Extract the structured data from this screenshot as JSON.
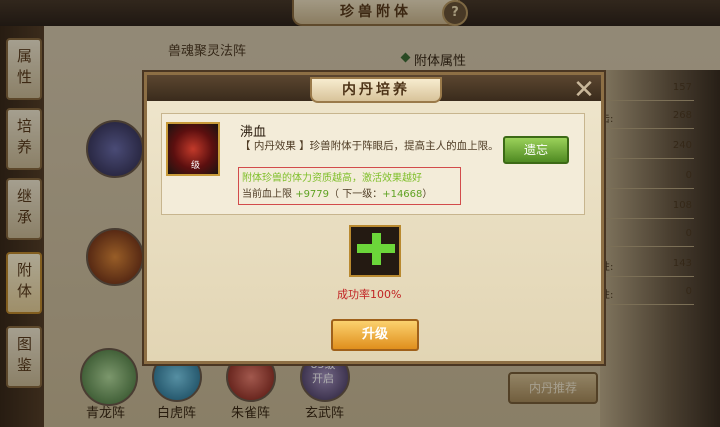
{
  "page_title": "珍兽附体",
  "side_tabs": [
    "属性",
    "培养",
    "继承",
    "附体",
    "图鉴"
  ],
  "formation": {
    "title": "兽魂聚灵法阵",
    "slots": [
      {
        "label": "青龙阵",
        "color": "#5f9a45"
      },
      {
        "label": "白虎阵",
        "color": "#3a8fb0"
      },
      {
        "label": "朱雀阵",
        "color": "#c0392b"
      },
      {
        "label": "玄武阵",
        "color": "#6b5a87",
        "lock_level": "85级",
        "lock_text": "开启"
      }
    ]
  },
  "attributes": {
    "title": "附体属性",
    "rows": [
      {
        "label": "",
        "value": "157"
      },
      {
        "label": "击:",
        "value": "268"
      },
      {
        "label": "",
        "value": "240"
      },
      {
        "label": "",
        "value": "0"
      },
      {
        "label": "",
        "value": "108"
      },
      {
        "label": "",
        "value": "0"
      },
      {
        "label": "性:",
        "value": "143"
      },
      {
        "label": "性:",
        "value": "0"
      }
    ],
    "recommend_button": "内丹推荐"
  },
  "modal": {
    "title": "内丹培养",
    "item_name": "沸血",
    "item_level": "级",
    "effect_text": "【 内丹效果 】珍兽附体于阵眼后，提高主人的血上限。",
    "tip": "附体珍兽的体力资质越高，激活效果越好",
    "hp_label": "当前血上限",
    "hp_value": "+9779",
    "next_prefix": "（ 下一级：",
    "next_value": "+14668",
    "next_suffix": "）",
    "forget_button": "遗忘",
    "success_rate": "成功率100%",
    "upgrade_button": "升级"
  }
}
